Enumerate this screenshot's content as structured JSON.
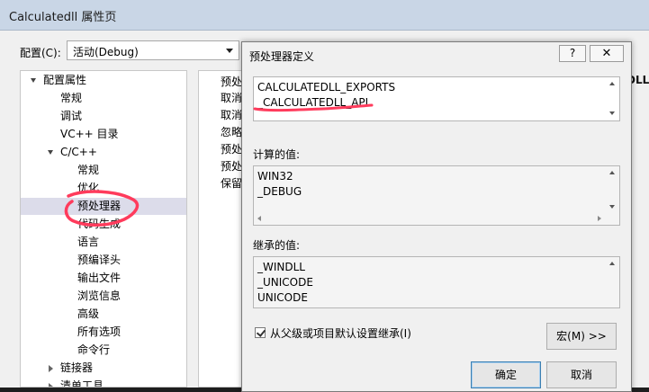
{
  "window": {
    "title": "Calculatedll 属性页"
  },
  "config": {
    "label": "配置(C):",
    "value": "活动(Debug)"
  },
  "tree": {
    "items": [
      {
        "label": "配置属性",
        "level": 0,
        "expanded": true
      },
      {
        "label": "常规",
        "level": 1
      },
      {
        "label": "调试",
        "level": 1
      },
      {
        "label": "VC++ 目录",
        "level": 1
      },
      {
        "label": "C/C++",
        "level": 1,
        "expanded": true
      },
      {
        "label": "常规",
        "level": 2
      },
      {
        "label": "优化",
        "level": 2
      },
      {
        "label": "预处理器",
        "level": 2,
        "selected": true
      },
      {
        "label": "代码生成",
        "level": 2
      },
      {
        "label": "语言",
        "level": 2
      },
      {
        "label": "预编译头",
        "level": 2
      },
      {
        "label": "输出文件",
        "level": 2
      },
      {
        "label": "浏览信息",
        "level": 2
      },
      {
        "label": "高级",
        "level": 2
      },
      {
        "label": "所有选项",
        "level": 2
      },
      {
        "label": "命令行",
        "level": 2
      },
      {
        "label": "链接器",
        "level": 1,
        "expanded": false
      },
      {
        "label": "清单工具",
        "level": 1,
        "expanded": false
      }
    ]
  },
  "grid": {
    "rows": [
      "预处",
      "取消",
      "取消",
      "忽略",
      "预处",
      "预处",
      "保留"
    ]
  },
  "right_partial": "DLL",
  "dialog": {
    "title": "预处理器定义",
    "help_label": "?",
    "close_label": "✕",
    "definitions": [
      "CALCULATEDLL_EXPORTS",
      "_CALCULATEDLL_API"
    ],
    "evaluated_label": "计算的值:",
    "evaluated": [
      "WIN32",
      "_DEBUG"
    ],
    "inherited_label": "继承的值:",
    "inherited": [
      "_WINDLL",
      "_UNICODE",
      "UNICODE"
    ],
    "inherit_checkbox_label": "从父级或项目默认设置继承(I)",
    "inherit_checked": true,
    "macro_button": "宏(M) >>",
    "ok_button": "确定",
    "cancel_button": "取消"
  },
  "colors": {
    "annotation": "#ff3b5c",
    "title_bar": "#c9d6e6",
    "selection": "#dcdcea"
  }
}
